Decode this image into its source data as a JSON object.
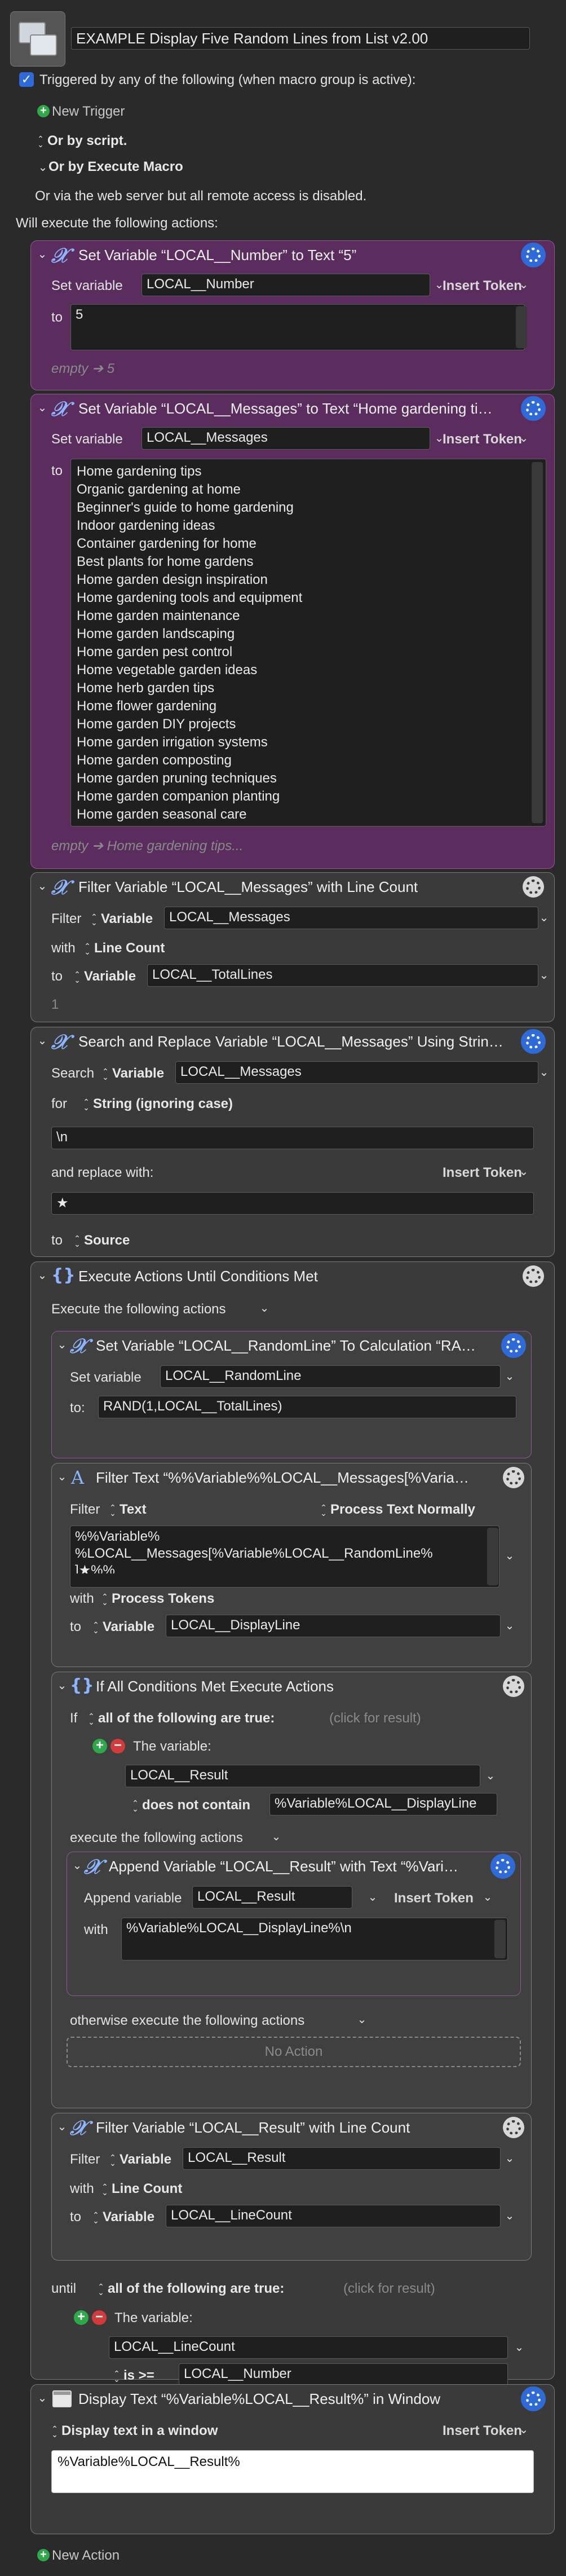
{
  "macro": {
    "name": "EXAMPLE Display Five Random Lines from List v2.00",
    "triggered_label": "Triggered by any of the following (when macro group is active):",
    "new_trigger": "New Trigger",
    "or_by_script": "Or by script.",
    "or_by_execute": "Or by Execute Macro",
    "web_server_note": "Or via the web server but all remote access is disabled.",
    "will_execute": "Will execute the following actions:",
    "new_action": "New Action"
  },
  "a1": {
    "title": "Set Variable “LOCAL__Number” to Text “5”",
    "set_variable_label": "Set variable",
    "variable": "LOCAL__Number",
    "insert_token": "Insert Token",
    "to_label": "to",
    "text": "5",
    "result": "empty ➔ 5"
  },
  "a2": {
    "title": "Set Variable “LOCAL__Messages” to Text “Home gardening ti…",
    "set_variable_label": "Set variable",
    "variable": "LOCAL__Messages",
    "insert_token": "Insert Token",
    "to_label": "to",
    "lines": [
      "Home gardening tips",
      "Organic gardening at home",
      "Beginner's guide to home gardening",
      "Indoor gardening ideas",
      "Container gardening for home",
      "Best plants for home gardens",
      "Home garden design inspiration",
      "Home gardening tools and equipment",
      "Home garden maintenance",
      "Home garden landscaping",
      "Home garden pest control",
      "Home vegetable garden ideas",
      "Home herb garden tips",
      "Home flower gardening",
      "Home garden DIY projects",
      "Home garden irrigation systems",
      "Home garden composting",
      "Home garden pruning techniques",
      "Home garden companion planting",
      "Home garden seasonal care"
    ],
    "result": "empty ➔ Home gardening tips..."
  },
  "a3": {
    "title": "Filter Variable “LOCAL__Messages” with Line Count",
    "filter_label": "Filter",
    "filter_source": "Variable",
    "filter_var": "LOCAL__Messages",
    "with_label": "with",
    "with_value": "Line Count",
    "to_label": "to",
    "to_source": "Variable",
    "to_var": "LOCAL__TotalLines",
    "result": "1"
  },
  "a4": {
    "title": "Search and Replace Variable “LOCAL__Messages” Using Strin…",
    "search_label": "Search",
    "search_source": "Variable",
    "search_var": "LOCAL__Messages",
    "for_label": "for",
    "for_value": "String (ignoring case)",
    "search_text": "\\n",
    "replace_label": "and replace with:",
    "insert_token": "Insert Token",
    "replace_text": "★",
    "to_label": "to",
    "to_value": "Source"
  },
  "a5": {
    "title": "Execute Actions Until Conditions Met",
    "execute_label": "Execute the following actions",
    "until_label": "until",
    "until_match": "all of the following are true:",
    "click_result": "(click for result)",
    "cond_label": "The variable:",
    "cond_var": "LOCAL__LineCount",
    "cond_op": "is >=",
    "cond_value": "LOCAL__Number"
  },
  "b1": {
    "title": "Set Variable “LOCAL__RandomLine” To Calculation “RA…",
    "set_variable_label": "Set variable",
    "variable": "LOCAL__RandomLine",
    "to_label": "to:",
    "calc": "RAND(1,LOCAL__TotalLines)"
  },
  "b2": {
    "title": "Filter Text “%%Variable%%LOCAL__Messages[%Varia…",
    "filter_label": "Filter",
    "filter_source": "Text",
    "process_mode": "Process Text Normally",
    "text_lines": [
      "%%Variable%",
      "%LOCAL__Messages[%Variable%LOCAL__RandomLine%",
      "]★%%"
    ],
    "with_label": "with",
    "with_value": "Process Tokens",
    "to_label": "to",
    "to_source": "Variable",
    "to_var": "LOCAL__DisplayLine"
  },
  "b3": {
    "title": "If All Conditions Met Execute Actions",
    "if_label": "If",
    "if_match": "all of the following are true:",
    "click_result": "(click for result)",
    "cond_label": "The variable:",
    "cond_var": "LOCAL__Result",
    "cond_op": "does not contain",
    "cond_value": "%Variable%LOCAL__DisplayLine",
    "execute_label": "execute the following actions",
    "otherwise_label": "otherwise execute the following actions",
    "no_action": "No Action"
  },
  "c1": {
    "title": "Append Variable “LOCAL__Result” with Text “%Vari…",
    "append_label": "Append variable",
    "variable": "LOCAL__Result",
    "insert_token": "Insert Token",
    "with_label": "with",
    "text": "%Variable%LOCAL__DisplayLine%\\n"
  },
  "b4": {
    "title": "Filter Variable “LOCAL__Result” with Line Count",
    "filter_label": "Filter",
    "filter_source": "Variable",
    "filter_var": "LOCAL__Result",
    "with_label": "with",
    "with_value": "Line Count",
    "to_label": "to",
    "to_source": "Variable",
    "to_var": "LOCAL__LineCount"
  },
  "a6": {
    "title": "Display Text “%Variable%LOCAL__Result%” in Window",
    "mode": "Display text in a window",
    "insert_token": "Insert Token",
    "text": "%Variable%LOCAL__Result%"
  }
}
